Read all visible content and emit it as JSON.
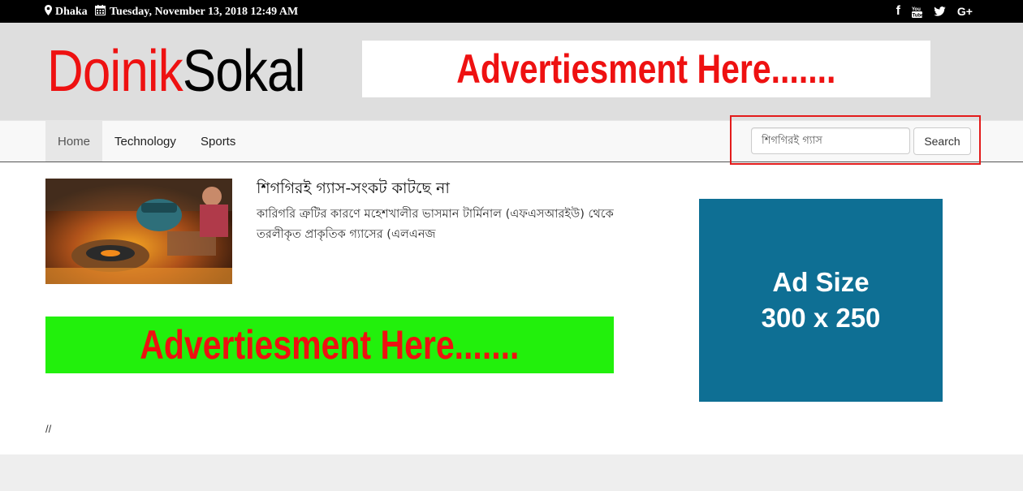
{
  "topbar": {
    "location": "Dhaka",
    "location_icon": "map-marker-icon",
    "date": "Tuesday, November 13, 2018 12:49 AM",
    "date_icon": "calendar-icon",
    "social": [
      "facebook-icon",
      "youtube-icon",
      "twitter-icon",
      "google-plus-icon"
    ]
  },
  "header": {
    "logo_part1": "Doinik",
    "logo_part2": "Sokal",
    "ad_text": "Advertiesment Here......."
  },
  "nav": {
    "items": [
      {
        "label": "Home"
      },
      {
        "label": "Technology"
      },
      {
        "label": "Sports"
      }
    ]
  },
  "search": {
    "value": "শিগগিরই গ্যাস",
    "button_label": "Search"
  },
  "article": {
    "title": "শিগগিরই গ্যাস-সংকট কাটছে না",
    "excerpt": "কারিগরি ত্রুটির কারণে মহেশখালীর ভাসমান টার্মিনাল (এফএসআরইউ) থেকে তরলীকৃত প্রাকৃতিক গ্যাসের (এলএনজ"
  },
  "mid_ad": {
    "text": "Advertiesment Here......."
  },
  "side_ad": {
    "line1": "Ad Size",
    "line2": "300 x 250"
  },
  "comment_text": "//",
  "colors": {
    "brand_red": "#ee1111",
    "side_ad_bg": "#0e6f94",
    "mid_ad_bg": "#22f00c",
    "highlight": "#e31b1b"
  }
}
